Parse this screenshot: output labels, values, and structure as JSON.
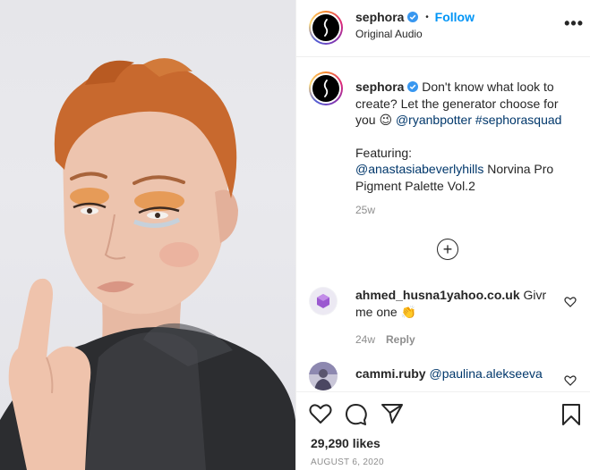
{
  "post": {
    "username": "sephora",
    "follow_label": "Follow",
    "separator": "•",
    "audio_label": "Original Audio",
    "more_label": "•••"
  },
  "caption": {
    "username": "sephora",
    "text_1": "Don't know what look to create? Let the generator choose for you",
    "emoji": "😉",
    "mention_1": "@ryanbpotter",
    "hashtag_1": "#sephorasquad",
    "featuring_label": "Featuring:",
    "mention_2": "@anastasiabeverlyhills",
    "product": "Norvina Pro Pigment Palette Vol.2",
    "timestamp": "25w"
  },
  "load_more_label": "+",
  "comments": [
    {
      "username": "ahmed_husna1yahoo.co.uk",
      "text": "Givr me one",
      "emoji": "👏",
      "time": "24w",
      "reply_label": "Reply"
    },
    {
      "username": "cammi.ruby",
      "mention": "@paulina.alekseeva"
    }
  ],
  "likes": "29,290 likes",
  "date": "AUGUST 6, 2020",
  "colors": {
    "link": "#00376b",
    "follow": "#0095f6",
    "verified": "#3897f0",
    "muted": "#8e8e8e",
    "text": "#262626"
  }
}
